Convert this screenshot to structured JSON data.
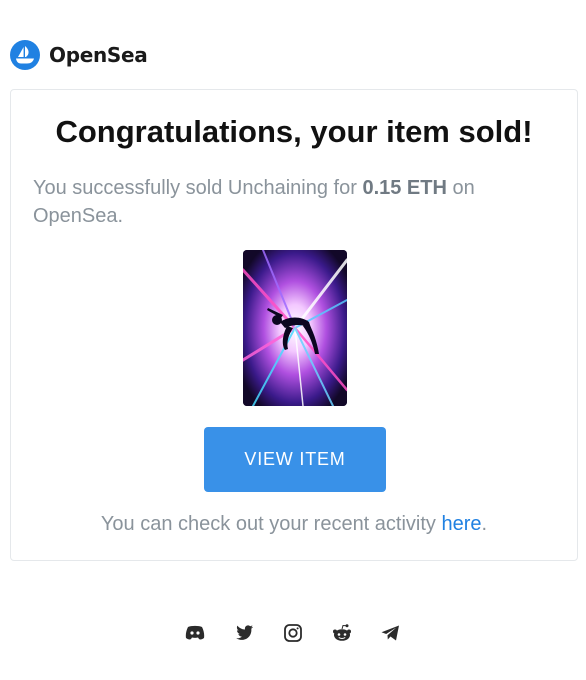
{
  "brand": {
    "name": "OpenSea",
    "logo_icon": "opensea-logo-icon",
    "color": "#2081e2"
  },
  "email": {
    "title": "Congratulations, your item sold!",
    "message_prefix": "You successfully sold Unchaining for ",
    "price": "0.15 ETH",
    "message_suffix": " on OpenSea.",
    "nft_image_icon": "nft-artwork-image",
    "button_label": "VIEW ITEM",
    "button_color": "#3991e8",
    "footer_prefix": "You can check out your recent activity ",
    "footer_link": "here",
    "footer_suffix": "."
  },
  "social": [
    {
      "icon": "discord-icon"
    },
    {
      "icon": "twitter-icon"
    },
    {
      "icon": "instagram-icon"
    },
    {
      "icon": "reddit-icon"
    },
    {
      "icon": "telegram-icon"
    }
  ]
}
